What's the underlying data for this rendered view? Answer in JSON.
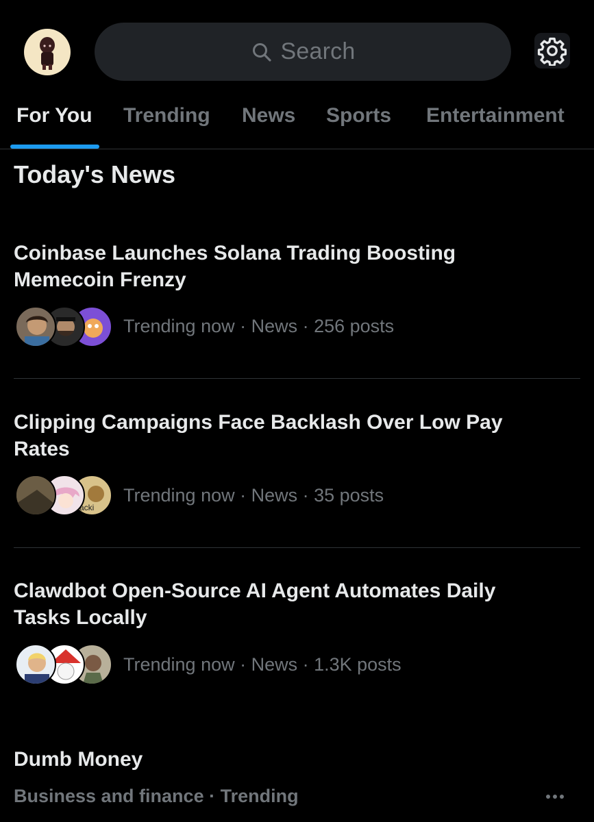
{
  "header": {
    "search_placeholder": "Search",
    "icons": {
      "search": "search-icon",
      "settings": "gear-icon"
    }
  },
  "tabs": [
    {
      "label": "For You",
      "active": true
    },
    {
      "label": "Trending",
      "active": false
    },
    {
      "label": "News",
      "active": false
    },
    {
      "label": "Sports",
      "active": false
    },
    {
      "label": "Entertainment",
      "active": false
    }
  ],
  "section": {
    "title": "Today's News"
  },
  "stories": [
    {
      "title": "Coinbase Launches Solana Trading Boosting Memecoin Frenzy",
      "meta": "Trending now · News · 256 posts"
    },
    {
      "title": "Clipping Campaigns Face Backlash Over Low Pay Rates",
      "meta": "Trending now · News · 35 posts",
      "avatar_text": "acki"
    },
    {
      "title": "Clawdbot Open-Source AI Agent Automates Daily Tasks Locally",
      "meta": "Trending now · News · 1.3K posts"
    }
  ],
  "trend": {
    "title": "Dumb Money",
    "subtitle": "Business and finance · Trending"
  },
  "colors": {
    "background": "#000000",
    "text_primary": "#e7e9ea",
    "text_secondary": "#71767b",
    "accent": "#1d9bf0",
    "divider": "#2f3336",
    "search_bg": "#202327"
  }
}
